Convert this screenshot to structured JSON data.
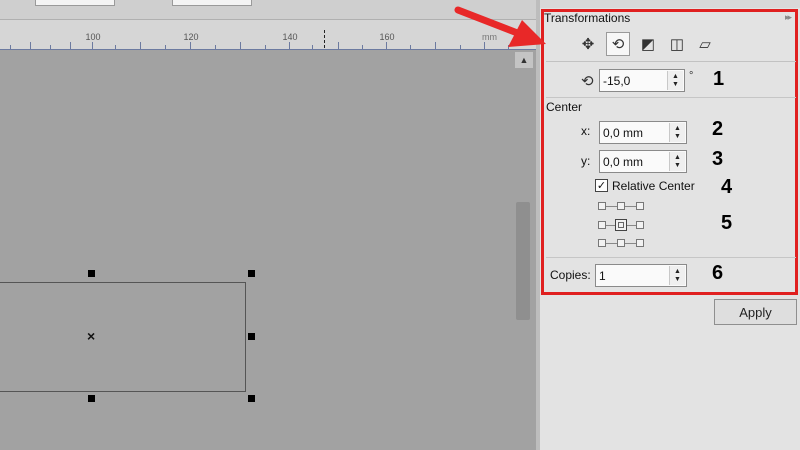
{
  "ruler": {
    "numbers": [
      "100",
      "120",
      "140",
      "160"
    ],
    "unit": "mm"
  },
  "canvas": {
    "center_marker": "×",
    "scroll_up_glyph": "▲"
  },
  "panel": {
    "title": "Transformations",
    "collapse_glyph": "▸▸",
    "tabs": [
      {
        "icon": "position-icon",
        "glyph": "✥"
      },
      {
        "icon": "rotate-icon",
        "glyph": "⟲"
      },
      {
        "icon": "scale-mirror-icon",
        "glyph": "◩"
      },
      {
        "icon": "size-icon",
        "glyph": "◫"
      },
      {
        "icon": "skew-icon",
        "glyph": "▱"
      }
    ],
    "rotation": {
      "icon": "rotate-icon",
      "glyph": "⟲",
      "value": "-15,0",
      "unit": "°"
    },
    "center_label": "Center",
    "x_label": "x:",
    "x_value": "0,0 mm",
    "y_label": "y:",
    "y_value": "0,0 mm",
    "relative_center_label": "Relative Center",
    "relative_center_checked": true,
    "check_glyph": "✓",
    "copies_label": "Copies:",
    "copies_value": "1",
    "apply_label": "Apply",
    "spin_up": "▲",
    "spin_down": "▼"
  },
  "annotations": [
    "1",
    "2",
    "3",
    "4",
    "5",
    "6"
  ],
  "colors": {
    "highlight_frame": "#e02020",
    "arrow": "#e82828"
  }
}
